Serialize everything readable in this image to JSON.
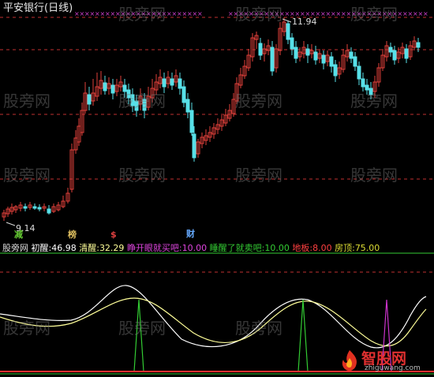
{
  "title": "平安银行(日线)",
  "colors": {
    "background": "#000000",
    "bull": "#e0403a",
    "bear": "#57e0e8",
    "dash": "#c03030",
    "x_marks": "#d040d0",
    "white_line": "#ffffff",
    "yellow_line": "#ffff99",
    "signal_green": "#33cc33",
    "signal_magenta": "#cc33cc",
    "baseline_red": "#ff3030",
    "sep_green": "#33cc33"
  },
  "price_labels": {
    "high": "11.94",
    "low": "9.14"
  },
  "markers": [
    {
      "name": "marker-jian",
      "text": "减",
      "color": "#66cc33"
    },
    {
      "name": "marker-bang",
      "text": "榜",
      "color": "#e0c060"
    },
    {
      "name": "marker-s",
      "text": "$",
      "color": "#e04040"
    },
    {
      "name": "marker-cai",
      "text": "财",
      "color": "#66aaff"
    }
  ],
  "indicator_bar": {
    "name_text": "股旁网",
    "chu_xing_label": "初醒:",
    "chu_xing_value": "46.98",
    "qing_xing_label": "清醒:",
    "qing_xing_value": "32.29",
    "buy_label": "睁开眼就买吧:",
    "buy_value": "10.00",
    "sell_label": "睡醒了就卖吧:",
    "sell_value": "10.00",
    "floor_label": "地板:",
    "floor_value": "8.00",
    "roof_label": "房顶:",
    "roof_value": "75.00"
  },
  "watermark": "股旁网",
  "logo": {
    "brand": "智股网",
    "url": "zhiguwang.com"
  }
}
